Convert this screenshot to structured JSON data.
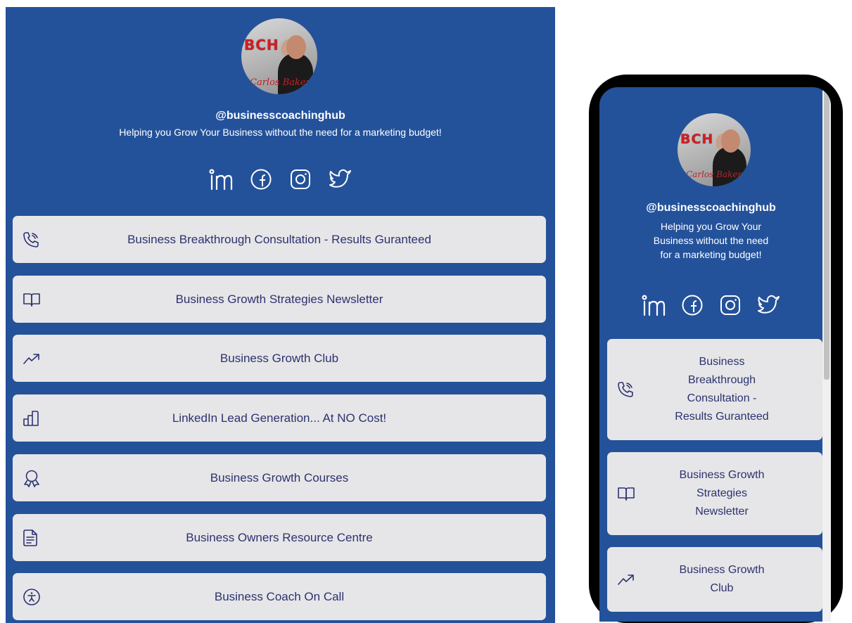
{
  "profile": {
    "handle": "@businesscoachinghub",
    "tagline": "Helping you Grow Your Business without the need for a marketing budget!",
    "tagline_lines": [
      "Helping you Grow Your",
      "Business without the need",
      "for a marketing budget!"
    ],
    "avatar_logo_text": "BCH",
    "avatar_signature": "Carlos Baker"
  },
  "social_icons": [
    "linkedin-icon",
    "facebook-icon",
    "instagram-icon",
    "twitter-icon"
  ],
  "links": [
    {
      "label": "Business Breakthrough Consultation - Results Guranteed",
      "icon": "phone-call-icon",
      "mobile_lines": [
        "Business",
        "Breakthrough",
        "Consultation -",
        "Results Guranteed"
      ]
    },
    {
      "label": "Business Growth Strategies Newsletter",
      "icon": "book-open-icon",
      "mobile_lines": [
        "Business Growth",
        "Strategies",
        "Newsletter"
      ]
    },
    {
      "label": "Business Growth Club",
      "icon": "trending-up-icon",
      "mobile_lines": [
        "Business Growth",
        "Club"
      ]
    },
    {
      "label": "LinkedIn Lead Generation... At NO Cost!",
      "icon": "bar-chart-icon"
    },
    {
      "label": "Business Growth Courses",
      "icon": "award-icon"
    },
    {
      "label": "Business Owners Resource Centre",
      "icon": "document-icon"
    },
    {
      "label": "Business Coach On Call",
      "icon": "accessibility-icon"
    }
  ],
  "colors": {
    "background": "#24529a",
    "button_bg": "#e6e6e8",
    "button_text": "#2c3270",
    "text": "#ffffff"
  }
}
